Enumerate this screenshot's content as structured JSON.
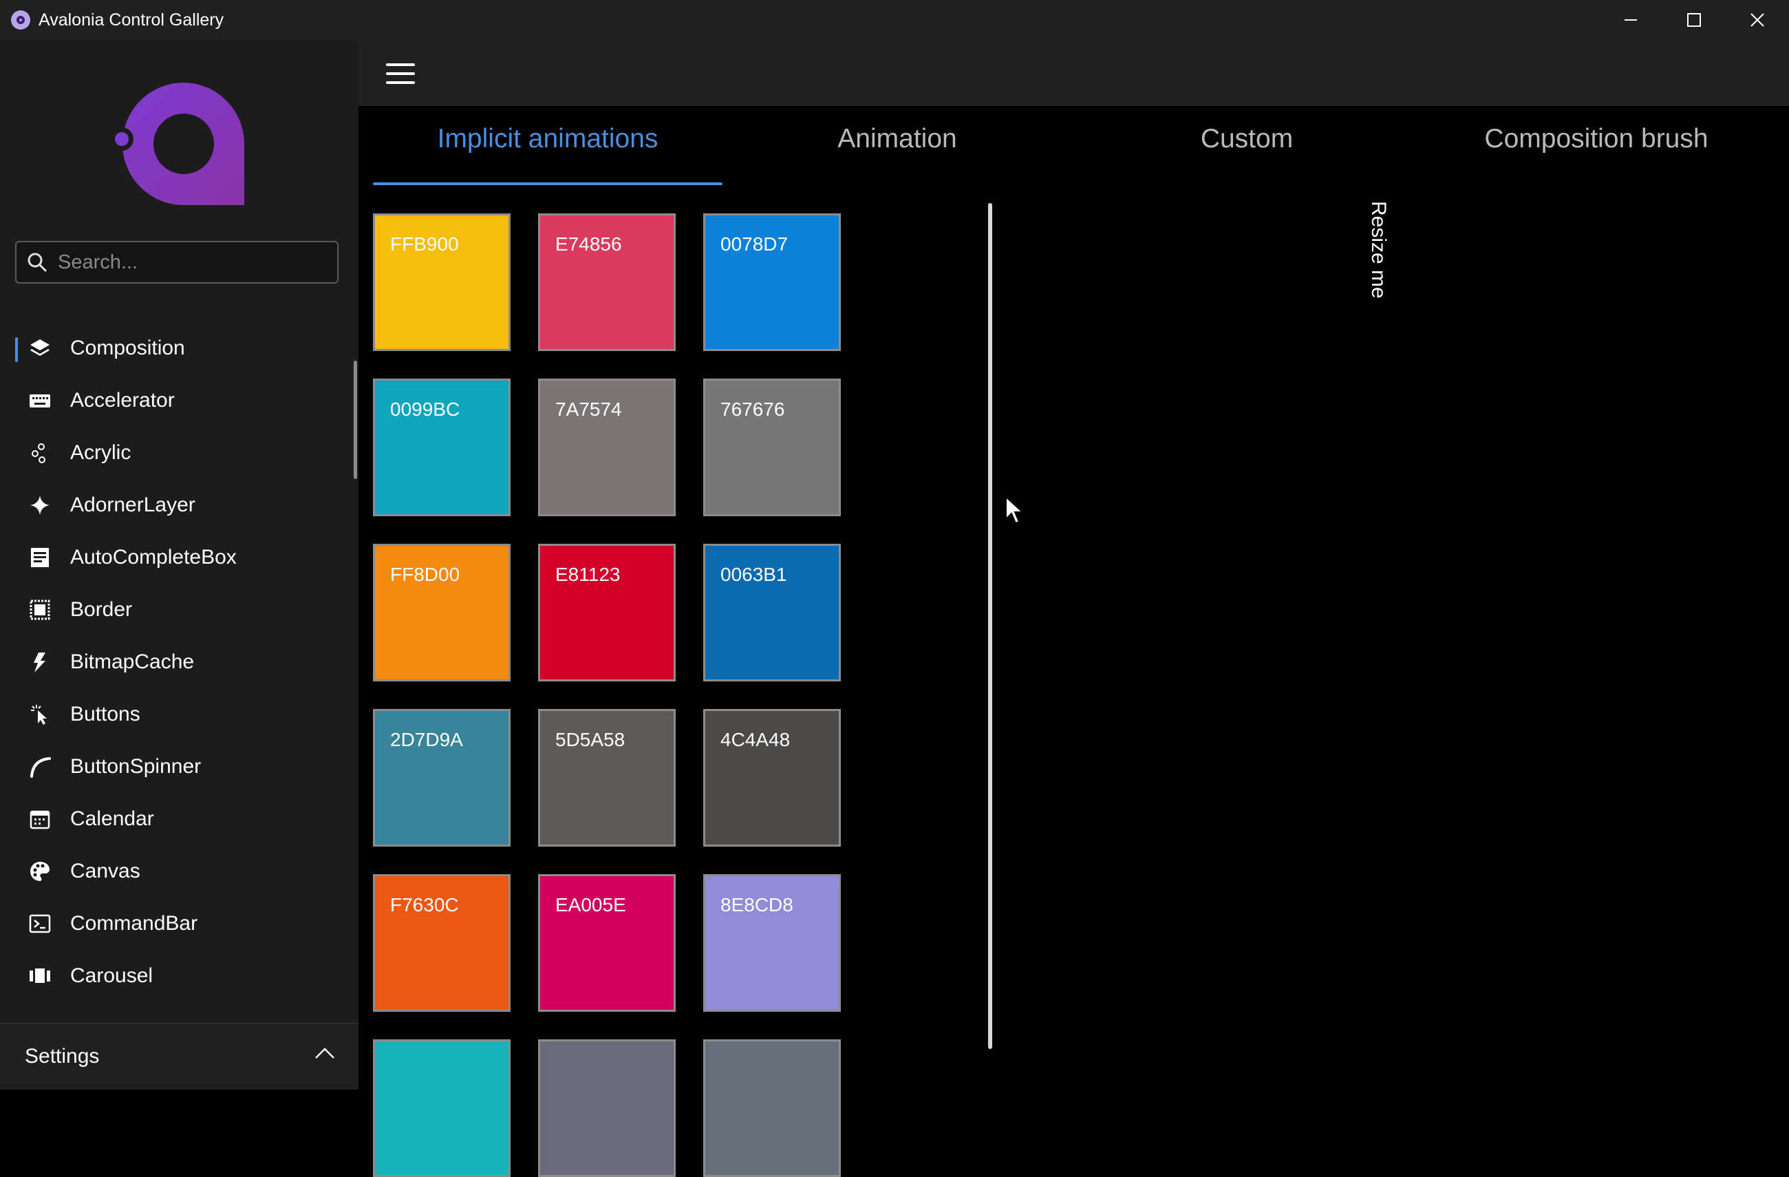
{
  "window": {
    "title": "Avalonia Control Gallery",
    "controls": [
      "minimize-icon",
      "maximize-icon",
      "close-icon"
    ]
  },
  "sidebar": {
    "logo": "avalonia-logo",
    "search": {
      "placeholder": "Search...",
      "value": ""
    },
    "items": [
      {
        "label": "Composition",
        "icon": "layers-icon",
        "selected": true
      },
      {
        "label": "Accelerator",
        "icon": "keyboard-icon"
      },
      {
        "label": "Acrylic",
        "icon": "bubbles-icon"
      },
      {
        "label": "AdornerLayer",
        "icon": "sparkle-icon"
      },
      {
        "label": "AutoCompleteBox",
        "icon": "document-icon"
      },
      {
        "label": "Border",
        "icon": "border-icon"
      },
      {
        "label": "BitmapCache",
        "icon": "flash-icon"
      },
      {
        "label": "Buttons",
        "icon": "cursor-click-icon"
      },
      {
        "label": "ButtonSpinner",
        "icon": "arc-icon"
      },
      {
        "label": "Calendar",
        "icon": "calendar-icon"
      },
      {
        "label": "Canvas",
        "icon": "palette-icon"
      },
      {
        "label": "CommandBar",
        "icon": "terminal-icon"
      },
      {
        "label": "Carousel",
        "icon": "carousel-icon"
      }
    ],
    "settings": {
      "label": "Settings",
      "icon": "chevron-up-icon"
    }
  },
  "tabs": [
    {
      "label": "Implicit animations",
      "active": true
    },
    {
      "label": "Animation"
    },
    {
      "label": "Custom"
    },
    {
      "label": "Composition brush"
    }
  ],
  "swatches": [
    {
      "label": "FFB900",
      "color": "#F6BE0C"
    },
    {
      "label": "E74856",
      "color": "#D93A5E"
    },
    {
      "label": "0078D7",
      "color": "#0B82D8"
    },
    {
      "label": "0099BC",
      "color": "#0FA6BD"
    },
    {
      "label": "7A7574",
      "color": "#7A7574"
    },
    {
      "label": "767676",
      "color": "#767676"
    },
    {
      "label": "FF8D00",
      "color": "#F48A0E"
    },
    {
      "label": "E81123",
      "color": "#D4002A"
    },
    {
      "label": "0063B1",
      "color": "#0A6AB0"
    },
    {
      "label": "2D7D9A",
      "color": "#37849B"
    },
    {
      "label": "5D5A58",
      "color": "#5D5A58"
    },
    {
      "label": "4C4A48",
      "color": "#4C4A48"
    },
    {
      "label": "F7630C",
      "color": "#EA5814"
    },
    {
      "label": "EA005E",
      "color": "#D3005E"
    },
    {
      "label": "8E8CD8",
      "color": "#918BD8"
    }
  ],
  "resize_panel": {
    "label": "Resize me"
  }
}
